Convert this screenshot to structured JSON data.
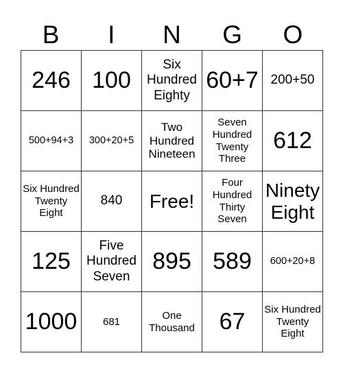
{
  "header": [
    "B",
    "I",
    "N",
    "G",
    "O"
  ],
  "rows": [
    [
      {
        "text": "246",
        "size": "xl"
      },
      {
        "text": "100",
        "size": "xl"
      },
      {
        "text": "Six Hundred Eighty",
        "size": "m"
      },
      {
        "text": "60+7",
        "size": "xl"
      },
      {
        "text": "200+50",
        "size": "m"
      }
    ],
    [
      {
        "text": "500+94+3",
        "size": "xs"
      },
      {
        "text": "300+20+5",
        "size": "xs"
      },
      {
        "text": "Two Hundred Nineteen",
        "size": "ms"
      },
      {
        "text": "Seven Hundred Twenty Three",
        "size": "s"
      },
      {
        "text": "612",
        "size": "xl"
      }
    ],
    [
      {
        "text": "Six Hundred Twenty Eight",
        "size": "s"
      },
      {
        "text": "840",
        "size": "m"
      },
      {
        "text": "Free!",
        "size": "l"
      },
      {
        "text": "Four Hundred Thirty Seven",
        "size": "s"
      },
      {
        "text": "Ninety Eight",
        "size": "l"
      }
    ],
    [
      {
        "text": "125",
        "size": "xl"
      },
      {
        "text": "Five Hundred Seven",
        "size": "m"
      },
      {
        "text": "895",
        "size": "xl"
      },
      {
        "text": "589",
        "size": "xl"
      },
      {
        "text": "600+20+8",
        "size": "xs"
      }
    ],
    [
      {
        "text": "1000",
        "size": "xl"
      },
      {
        "text": "681",
        "size": "s"
      },
      {
        "text": "One Thousand",
        "size": "s"
      },
      {
        "text": "67",
        "size": "xl"
      },
      {
        "text": "Six Hundred Twenty Eight",
        "size": "s"
      }
    ]
  ]
}
